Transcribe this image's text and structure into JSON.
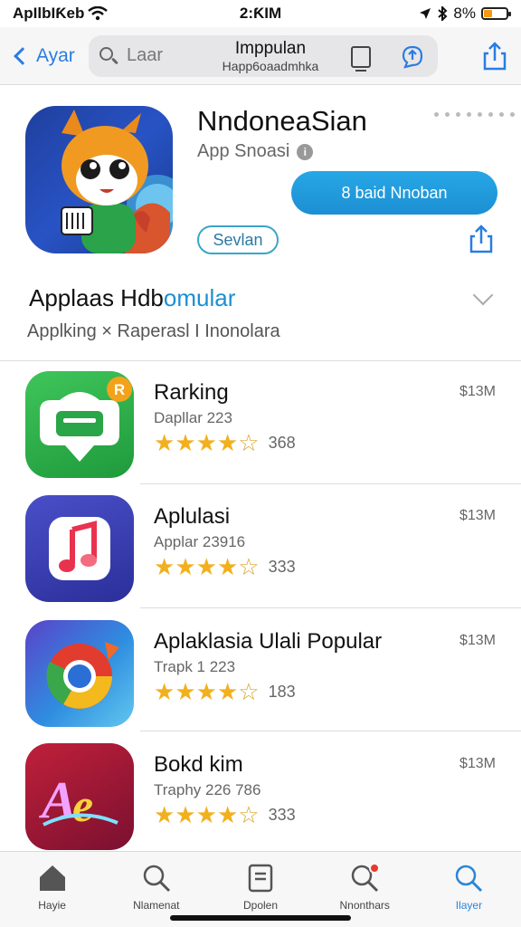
{
  "status": {
    "carrier": "ApIlbIƘeb",
    "time": "2:ƘIM",
    "battery": "8%"
  },
  "nav": {
    "back_label": "Ayar",
    "search_placeholder": "Laar",
    "title": "Imppulan",
    "subtitle": "Happ6oaadmhka"
  },
  "hero": {
    "title": "NndoneaSian",
    "subtitle": "App Snoasi",
    "get_label": "8 baid Nnoban",
    "pill_label": "Sevlan"
  },
  "section": {
    "title_main": "Applaas Hdb",
    "title_accent": "omular",
    "subtitle": "Applking × Raperasl I Inonolara"
  },
  "apps": [
    {
      "title": "Rarking",
      "meta": "Dapllar 223",
      "rating": 4.5,
      "count": "368",
      "price": "$13M",
      "icon": "chat-app-icon",
      "badge": "R"
    },
    {
      "title": "Aplulasi",
      "meta": "Applar 23916",
      "rating": 4.5,
      "count": "333",
      "price": "$13M",
      "icon": "music-app-icon"
    },
    {
      "title": "Aplaklasia Ulali Popular",
      "meta": "Trapk 1 223",
      "rating": 4.5,
      "count": "183",
      "price": "$13M",
      "icon": "browser-app-icon"
    },
    {
      "title": "Bokd kim",
      "meta": "Traphy 226 786",
      "rating": 4.5,
      "count": "333",
      "price": "$13M",
      "icon": "font-app-icon"
    }
  ],
  "tabs": [
    {
      "label": "Hayie",
      "icon": "home-icon"
    },
    {
      "label": "Nlamenat",
      "icon": "search-icon"
    },
    {
      "label": "Dpolen",
      "icon": "document-icon"
    },
    {
      "label": "Nnonthars",
      "icon": "search-badge-icon"
    },
    {
      "label": "Ilayer",
      "icon": "search-active-icon",
      "active": true
    }
  ],
  "colors": {
    "accent": "#1c8fd3",
    "link": "#2a7de1",
    "star": "#f2b01e"
  }
}
